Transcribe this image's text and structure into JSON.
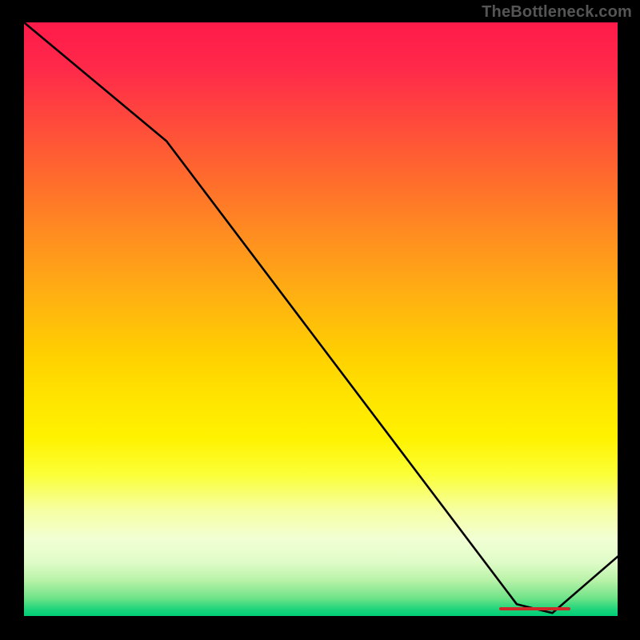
{
  "watermark": "TheBottleneck.com",
  "chart_data": {
    "type": "line",
    "title": "",
    "xlabel": "",
    "ylabel": "",
    "xlim": [
      0,
      100
    ],
    "ylim": [
      0,
      100
    ],
    "x": [
      0,
      24,
      83,
      89,
      100
    ],
    "y": [
      100,
      80,
      2,
      0.5,
      10
    ],
    "annotations": [
      {
        "kind": "optimum-marker",
        "x_start": 80,
        "x_end": 92,
        "y": 1.2
      }
    ],
    "background": "vertical-heat-gradient (red→orange→yellow→green)"
  },
  "colors": {
    "frame": "#000000",
    "curve": "#000000",
    "marker": "#d02828",
    "watermark": "#555555"
  }
}
